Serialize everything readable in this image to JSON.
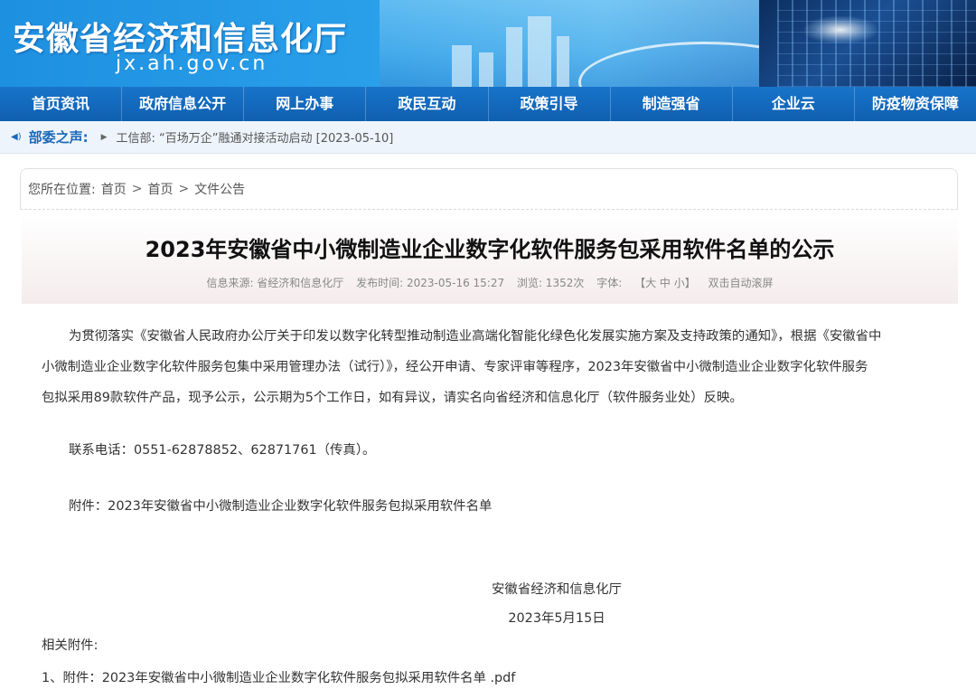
{
  "header": {
    "site_title": "安徽省经济和信息化厅",
    "site_url": "jx.ah.gov.cn"
  },
  "nav": [
    {
      "label": "首页资讯"
    },
    {
      "label": "政府信息公开"
    },
    {
      "label": "网上办事"
    },
    {
      "label": "政民互动"
    },
    {
      "label": "政策引导"
    },
    {
      "label": "制造强省"
    },
    {
      "label": "企业云"
    },
    {
      "label": "防疫物资保障"
    }
  ],
  "ticker": {
    "label": "部委之声:",
    "text": "工信部: “百场万企”融通对接活动启动 [2023-05-10]"
  },
  "breadcrumb": {
    "prefix": "您所在位置:",
    "items": [
      "首页",
      "首页",
      "文件公告"
    ]
  },
  "article": {
    "title": "2023年安徽省中小微制造业企业数字化软件服务包采用软件名单的公示",
    "meta": {
      "source": "信息来源: 省经济和信息化厅",
      "time": "发布时间: 2023-05-16 15:27",
      "views": "浏览: 1352次",
      "font_label": "字体:",
      "font_sizes": "【大 中 小】",
      "auto_scroll": "双击自动滚屏"
    },
    "paragraph_lines": [
      "为贯彻落实《安徽省人民政府办公厅关于印发以数字化转型推动制造业高端化智能化绿色化发展实施方案及支持政策的通知》，根据《安徽省中",
      "小微制造业企业数字化软件服务包集中采用管理办法（试行）》，经公开申请、专家评审等程序，2023年安徽省中小微制造业企业数字化软件服务",
      "包拟采用89款软件产品，现予公示，公示期为5个工作日，如有异议，请实名向省经济和信息化厅（软件服务业处）反映。"
    ],
    "contact": "联系电话：0551-62878852、62871761（传真）。",
    "attachment_note": "附件：2023年安徽省中小微制造业企业数字化软件服务包拟采用软件名单",
    "signature_org": "安徽省经济和信息化厅",
    "signature_date": "2023年5月15日",
    "related_label": "相关附件:",
    "related_file": "1、附件：2023年安徽省中小微制造业企业数字化软件服务包拟采用软件名单 .pdf"
  }
}
